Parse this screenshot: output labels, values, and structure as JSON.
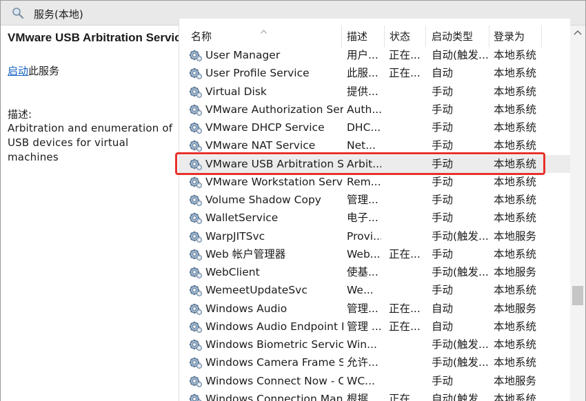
{
  "window": {
    "title": "服务(本地)"
  },
  "left_pane": {
    "service_title": "VMware USB Arbitration Service",
    "start_link": "启动",
    "start_suffix": "此服务",
    "desc_label": "描述:",
    "desc_text": "Arbitration and enumeration of USB devices for virtual machines"
  },
  "columns": {
    "name": "名称",
    "desc": "描述",
    "state": "状态",
    "startup": "启动类型",
    "logon": "登录为"
  },
  "rows": [
    {
      "name": "User Manager",
      "desc": "用户...",
      "state": "正在...",
      "startup": "自动(触发...",
      "logon": "本地系统"
    },
    {
      "name": "User Profile Service",
      "desc": "此服...",
      "state": "正在...",
      "startup": "自动",
      "logon": "本地系统"
    },
    {
      "name": "Virtual Disk",
      "desc": "提供...",
      "state": "",
      "startup": "手动",
      "logon": "本地系统"
    },
    {
      "name": "VMware Authorization Ser...",
      "desc": "Auth...",
      "state": "",
      "startup": "手动",
      "logon": "本地系统"
    },
    {
      "name": "VMware DHCP Service",
      "desc": "DHC...",
      "state": "",
      "startup": "手动",
      "logon": "本地系统"
    },
    {
      "name": "VMware NAT Service",
      "desc": "Net...",
      "state": "",
      "startup": "手动",
      "logon": "本地系统"
    },
    {
      "name": "VMware USB Arbitration S...",
      "desc": "Arbit...",
      "state": "",
      "startup": "手动",
      "logon": "本地系统"
    },
    {
      "name": "VMware Workstation Server",
      "desc": "Rem...",
      "state": "",
      "startup": "手动",
      "logon": "本地系统"
    },
    {
      "name": "Volume Shadow Copy",
      "desc": "管理...",
      "state": "",
      "startup": "手动",
      "logon": "本地系统"
    },
    {
      "name": "WalletService",
      "desc": "电子...",
      "state": "",
      "startup": "手动",
      "logon": "本地系统"
    },
    {
      "name": "WarpJITSvc",
      "desc": "Provi...",
      "state": "",
      "startup": "手动(触发...",
      "logon": "本地服务"
    },
    {
      "name": "Web 帐户管理器",
      "desc": "Web...",
      "state": "正在...",
      "startup": "手动",
      "logon": "本地系统"
    },
    {
      "name": "WebClient",
      "desc": "使基...",
      "state": "",
      "startup": "手动(触发...",
      "logon": "本地服务"
    },
    {
      "name": "WemeetUpdateSvc",
      "desc": "We...",
      "state": "",
      "startup": "手动",
      "logon": "本地系统"
    },
    {
      "name": "Windows Audio",
      "desc": "管理...",
      "state": "正在...",
      "startup": "自动",
      "logon": "本地服务"
    },
    {
      "name": "Windows Audio Endpoint B...",
      "desc": "管理 ...",
      "state": "正在...",
      "startup": "自动",
      "logon": "本地系统"
    },
    {
      "name": "Windows Biometric Service",
      "desc": "Win...",
      "state": "",
      "startup": "手动(触发...",
      "logon": "本地系统"
    },
    {
      "name": "Windows Camera Frame S...",
      "desc": "允许...",
      "state": "",
      "startup": "手动(触发...",
      "logon": "本地系统"
    },
    {
      "name": "Windows Connect Now - C...",
      "desc": "WC...",
      "state": "",
      "startup": "手动",
      "logon": "本地服务"
    },
    {
      "name": "Windows Connection Man...",
      "desc": "根据...",
      "state": "正在...",
      "startup": "自动(触发...",
      "logon": "本地系统"
    }
  ],
  "colors": {
    "highlight": "#e8302a",
    "link": "#1060c0",
    "selected_row": "#ececec"
  },
  "icons": {
    "title": "services-magnifier-icon",
    "row": "gear-service-icon"
  }
}
